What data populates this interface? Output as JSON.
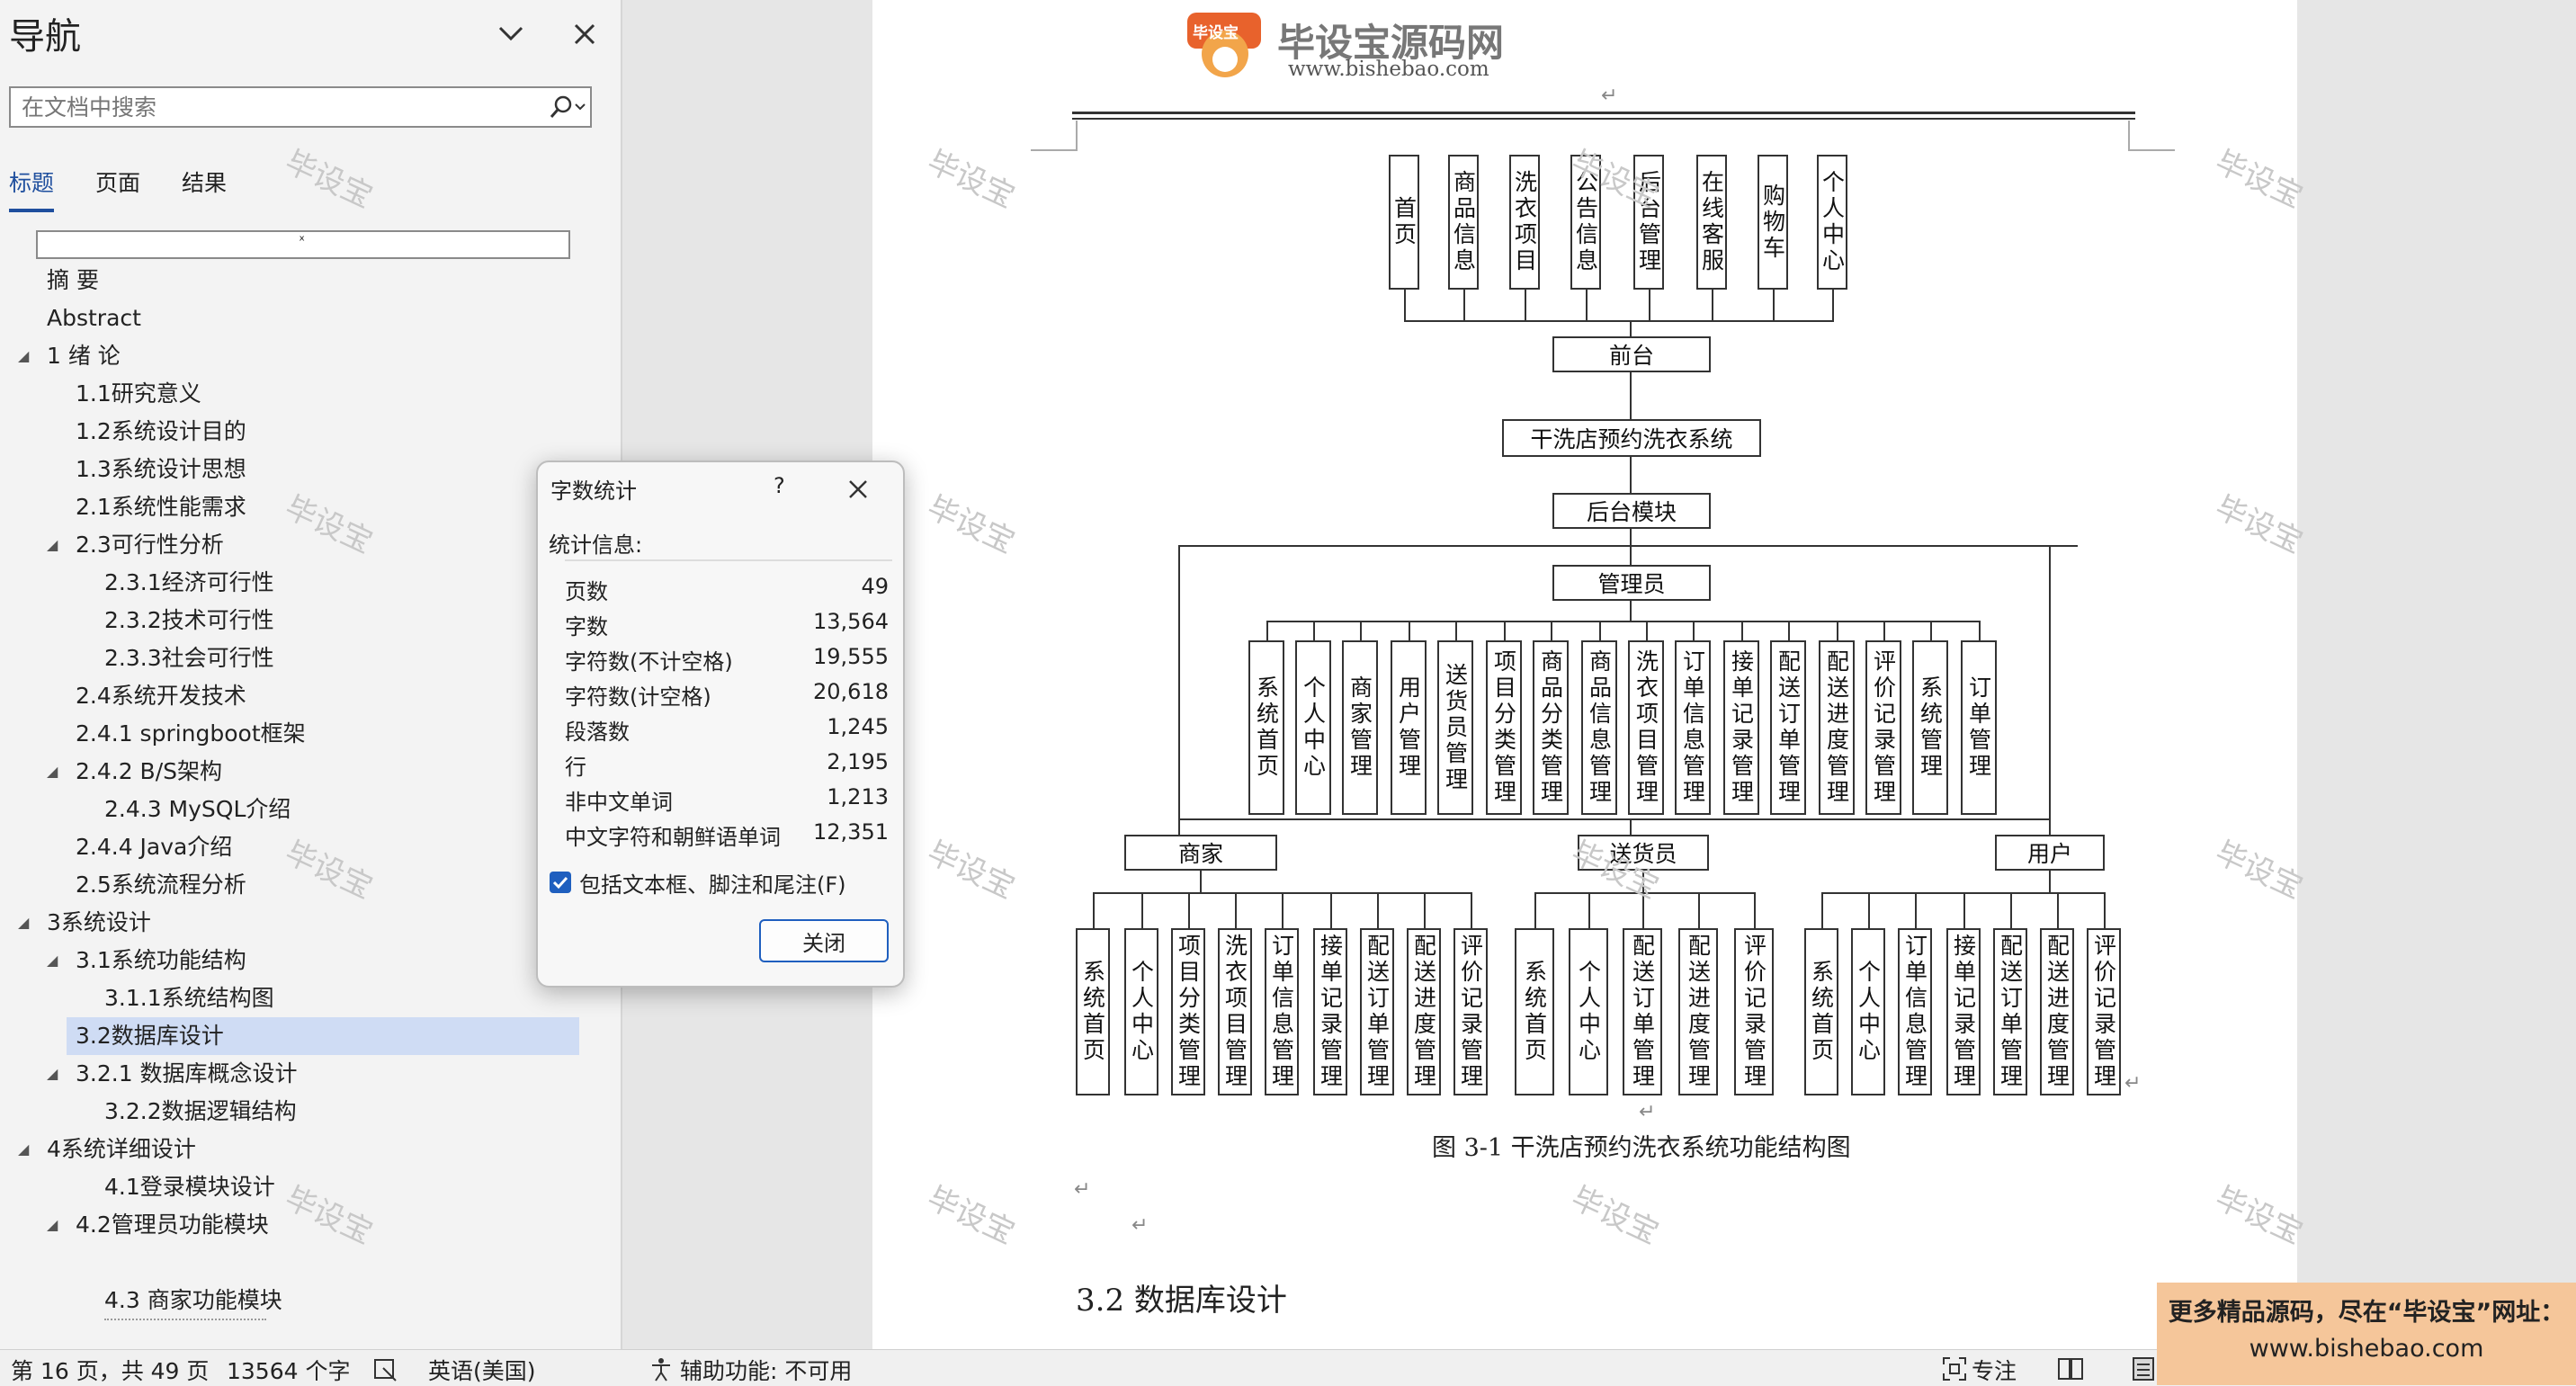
{
  "nav": {
    "title": "导航",
    "search_placeholder": "在文档中搜索",
    "tabs": [
      "标题",
      "页面",
      "结果"
    ],
    "blank_heading": "ˣ",
    "tree": [
      {
        "text": "摘 要"
      },
      {
        "text": "Abstract"
      },
      {
        "text": "1 绪 论"
      },
      {
        "text": "1.1研究意义"
      },
      {
        "text": "1.2系统设计目的"
      },
      {
        "text": "1.3系统设计思想"
      },
      {
        "text": "2.1系统性能需求"
      },
      {
        "text": "2.3可行性分析"
      },
      {
        "text": "2.3.1经济可行性"
      },
      {
        "text": "2.3.2技术可行性"
      },
      {
        "text": "2.3.3社会可行性"
      },
      {
        "text": "2.4系统开发技术"
      },
      {
        "text": "2.4.1 springboot框架"
      },
      {
        "text": "2.4.2 B/S架构"
      },
      {
        "text": "2.4.3 MySQL介绍"
      },
      {
        "text": "2.4.4 Java介绍"
      },
      {
        "text": "2.5系统流程分析"
      },
      {
        "text": "3系统设计"
      },
      {
        "text": "3.1系统功能结构"
      },
      {
        "text": "3.1.1系统结构图"
      },
      {
        "text": "3.2数据库设计"
      },
      {
        "text": "3.2.1 数据库概念设计"
      },
      {
        "text": "3.2.2数据逻辑结构"
      },
      {
        "text": "4系统详细设计"
      },
      {
        "text": "4.1登录模块设计"
      },
      {
        "text": "4.2管理员功能模块"
      },
      {
        "text": "4.3 商家功能模块"
      }
    ],
    "watermark": "毕设宝"
  },
  "dialog": {
    "title": "字数统计",
    "help": "?",
    "section": "统计信息:",
    "rows": [
      {
        "label": "页数",
        "value": "49"
      },
      {
        "label": "字数",
        "value": "13,564"
      },
      {
        "label": "字符数(不计空格)",
        "value": "19,555"
      },
      {
        "label": "字符数(计空格)",
        "value": "20,618"
      },
      {
        "label": "段落数",
        "value": "1,245"
      },
      {
        "label": "行",
        "value": "2,195"
      },
      {
        "label": "非中文单词",
        "value": "1,213"
      },
      {
        "label": "中文字符和朝鲜语单词",
        "value": "12,351"
      }
    ],
    "checkbox_label": "包括文本框、脚注和尾注(F)",
    "close_label": "关闭"
  },
  "doc": {
    "logo_title": "毕设宝源码网",
    "logo_badge": "毕设宝",
    "logo_url": "www.bishebao.com",
    "diagram": {
      "top_items": [
        "首页",
        "商品信息",
        "洗衣项目",
        "公告信息",
        "后台管理",
        "在线客服",
        "购物车",
        "个人中心"
      ],
      "frontend": "前台",
      "system": "干洗店预约洗衣系统",
      "backend": "后台模块",
      "admin": "管理员",
      "admin_items": [
        "系统首页",
        "个人中心",
        "商家管理",
        "用户管理",
        "送货员管理",
        "项目分类管理",
        "商品分类管理",
        "商品信息管理",
        "洗衣项目管理",
        "订单信息管理",
        "接单记录管理",
        "配送订单管理",
        "配送进度管理",
        "评价记录管理",
        "系统管理",
        "订单管理"
      ],
      "merchant": "商家",
      "merchant_items": [
        "系统首页",
        "个人中心",
        "项目分类管理",
        "洗衣项目管理",
        "订单信息管理",
        "接单记录管理",
        "配送订单管理",
        "配送进度管理",
        "评价记录管理"
      ],
      "courier": "送货员",
      "courier_items": [
        "系统首页",
        "个人中心",
        "配送订单管理",
        "配送进度管理",
        "评价记录管理"
      ],
      "user": "用户",
      "user_items": [
        "系统首页",
        "个人中心",
        "订单信息管理",
        "接单记录管理",
        "配送订单管理",
        "配送进度管理",
        "评价记录管理"
      ]
    },
    "caption": "图 3-1  干洗店预约洗衣系统功能结构图",
    "section_heading": "3.2 数据库设计",
    "para_mark": "↵"
  },
  "status": {
    "page": "第 16 页，共 49 页",
    "words": "13564 个字",
    "language": "英语(美国)",
    "accessibility": "辅助功能: 不可用",
    "focus": "专注"
  },
  "banner": {
    "line1": "更多精品源码，尽在“毕设宝”网址：",
    "line2": "www.bishebao.com"
  },
  "colors": {
    "accent": "#1f4f9e",
    "selected": "#cfdcf4",
    "banner": "#f5c69a"
  }
}
